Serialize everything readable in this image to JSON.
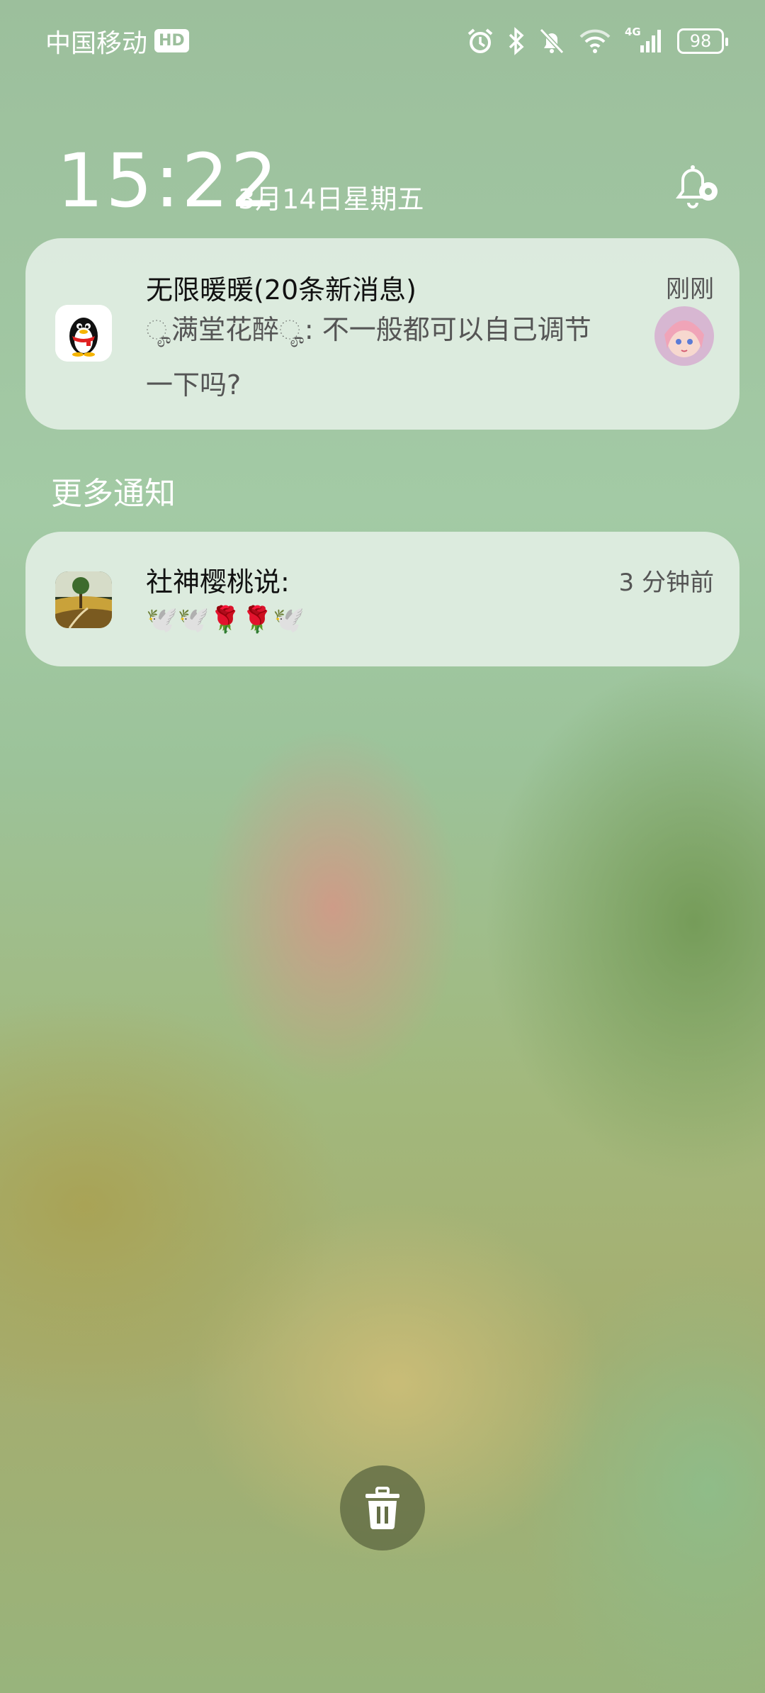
{
  "status_bar": {
    "carrier": "中国移动",
    "hd_badge": "HD",
    "network": "4G",
    "battery_level": "98",
    "icons": [
      "alarm-icon",
      "bluetooth-icon",
      "mute-bell-icon",
      "wifi-icon",
      "signal-icon",
      "battery-icon"
    ]
  },
  "lockscreen": {
    "time": "15:22",
    "date": "3月14日星期五",
    "settings_icon": "bell-settings-icon"
  },
  "notifications": [
    {
      "app_icon": "qq-penguin-icon",
      "title": "无限暖暖(20条新消息)",
      "time": "刚刚",
      "sender_prefix": "满堂花醉",
      "message": ": 不一般都可以自己调节一下吗?",
      "avatar": "anime-girl-avatar"
    }
  ],
  "more_section": {
    "title": "更多通知",
    "items": [
      {
        "app_icon": "landscape-app-icon",
        "title": "社神樱桃说:",
        "time": "3 分钟前",
        "message": "🕊️🕊️🌹🌹🕊️"
      }
    ]
  },
  "actions": {
    "clear_icon": "trash-icon"
  }
}
